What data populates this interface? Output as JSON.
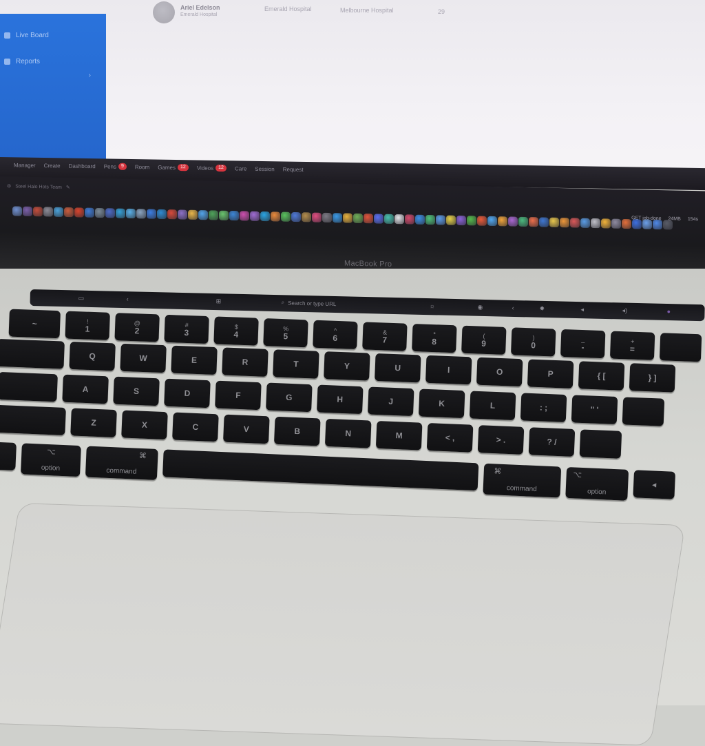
{
  "screen": {
    "sidebar": {
      "items": [
        {
          "label": "Live Board"
        },
        {
          "label": "Reports"
        }
      ]
    },
    "profile": {
      "name": "Ariel Edelson",
      "subtitle": "Emerald Hospital",
      "columns": [
        "Emerald Hospital",
        "Melbourne Hospital",
        "29"
      ]
    },
    "app_menu": {
      "items": [
        {
          "label": "Manager"
        },
        {
          "label": "Create"
        },
        {
          "label": "Dashboard"
        },
        {
          "label": "Pens",
          "badge": "9"
        },
        {
          "label": "Room"
        },
        {
          "label": "Games",
          "badge": "12"
        },
        {
          "label": "Videos",
          "badge": "12"
        },
        {
          "label": "Care"
        },
        {
          "label": "Session"
        },
        {
          "label": "Request"
        }
      ],
      "right": [
        "GET job-done",
        "24MB",
        "154s"
      ]
    },
    "path_bar": "Steel Halo Hots Team"
  },
  "dock": {
    "colors": [
      "#6f8fcf",
      "#7a5ea8",
      "#c24c3b",
      "#8a8a95",
      "#4aa0d8",
      "#c85c3d",
      "#d8442e",
      "#3e7bd6",
      "#7b8b99",
      "#4d6cc8",
      "#36a1d9",
      "#5ab0e8",
      "#8aa4c0",
      "#3c7de0",
      "#2f8ad1",
      "#d74a3b",
      "#8c70c6",
      "#e8b64a",
      "#53a4ea",
      "#4fa35a",
      "#69c46d",
      "#3d86d6",
      "#cc4fae",
      "#9f6bd3",
      "#2aa5e3",
      "#ea8a3c",
      "#59c25d",
      "#4f7ad9",
      "#b48d4c",
      "#e14d80",
      "#7d7a84",
      "#3a99e6",
      "#e7b13d",
      "#6fae57",
      "#e0543b",
      "#5a6ff0",
      "#48c0ae",
      "#e6e6ea",
      "#d34a6c",
      "#3d90e6",
      "#4ec17a",
      "#5d9ce8",
      "#e5d04a",
      "#8a63d8",
      "#55b84c",
      "#e95b3a",
      "#51a7ef",
      "#f0a43c",
      "#a968d1",
      "#4bb87d",
      "#eb6e4b",
      "#3f77d1",
      "#e7c54c",
      "#ec9639",
      "#d85858",
      "#5a9be3",
      "#c0c0c8",
      "#f2b33a",
      "#8f8ba0",
      "#e26f3b",
      "#3d6fe0",
      "#6ca0ea",
      "#4f88e6",
      "#585b66"
    ],
    "device_label": "MacBook Pro"
  },
  "touchbar": {
    "search_label": "Search or type URL"
  },
  "keyboard": {
    "row1": [
      {
        "top": "",
        "bot": "~"
      },
      {
        "top": "!",
        "bot": "1"
      },
      {
        "top": "@",
        "bot": "2"
      },
      {
        "top": "#",
        "bot": "3"
      },
      {
        "top": "$",
        "bot": "4"
      },
      {
        "top": "%",
        "bot": "5"
      },
      {
        "top": "^",
        "bot": "6"
      },
      {
        "top": "&",
        "bot": "7"
      },
      {
        "top": "*",
        "bot": "8"
      },
      {
        "top": "(",
        "bot": "9"
      },
      {
        "top": ")",
        "bot": "0"
      },
      {
        "top": "_",
        "bot": "-"
      },
      {
        "top": "+",
        "bot": "="
      },
      {
        "top": "",
        "bot": ""
      }
    ],
    "row2": [
      "",
      "Q",
      "W",
      "E",
      "R",
      "T",
      "Y",
      "U",
      "I",
      "O",
      "P",
      "{ [",
      "} ]"
    ],
    "row3": [
      "",
      "A",
      "S",
      "D",
      "F",
      "G",
      "H",
      "J",
      "K",
      "L",
      ": ;",
      "\" '",
      ""
    ],
    "row4": [
      "",
      "Z",
      "X",
      "C",
      "V",
      "B",
      "N",
      "M",
      "< ,",
      "> .",
      "? /",
      ""
    ],
    "row5": {
      "option_left": "option",
      "command_left": "command",
      "command_right": "command",
      "option_right": "option",
      "command_glyph": "⌘",
      "option_glyph": "⌥",
      "arrow_left": "◀"
    }
  }
}
